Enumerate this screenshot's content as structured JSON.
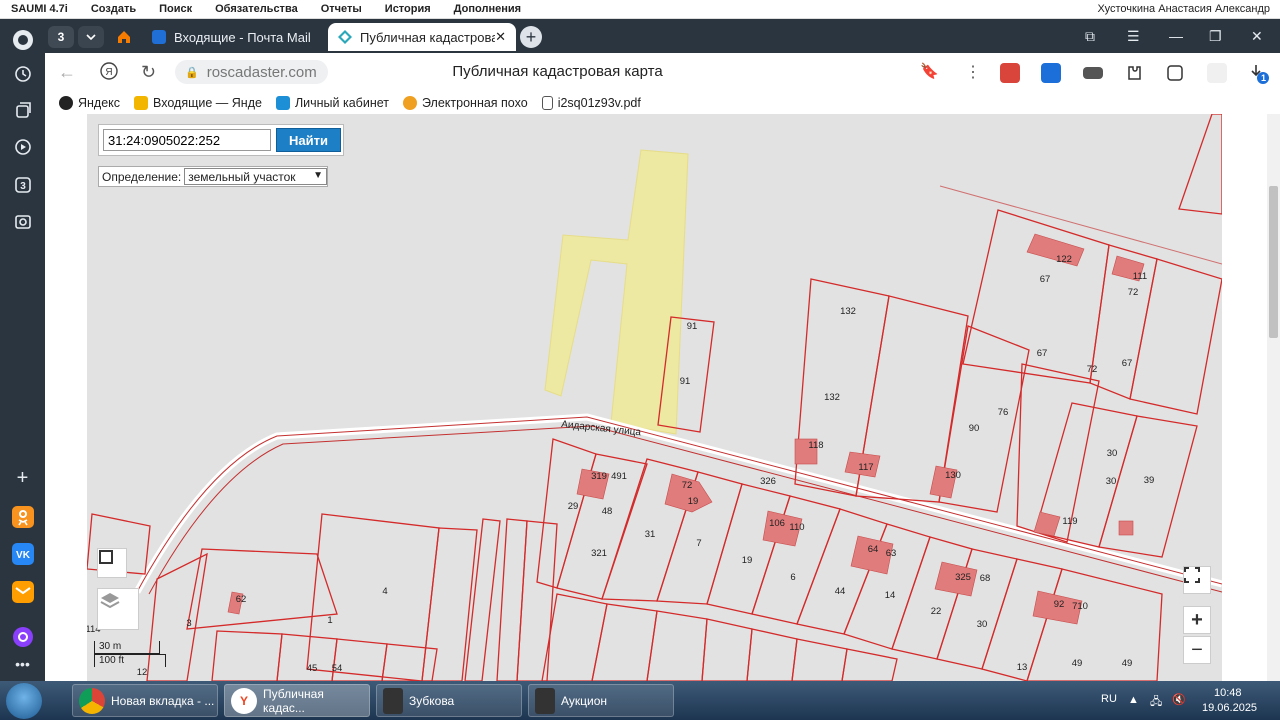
{
  "menubar": {
    "items": [
      "SAUMI 4.7i",
      "Создать",
      "Поиск",
      "Обязательства",
      "Отчеты",
      "История",
      "Дополнения"
    ],
    "user": "Хусточкина Анастасия Александр"
  },
  "browser": {
    "tab_counter": "3",
    "tabs": [
      {
        "label": "Входящие - Почта Mail",
        "active": false
      },
      {
        "label": "Публичная кадастрова",
        "active": true
      }
    ],
    "url": "roscadaster.com",
    "page_title": "Публичная кадастровая карта",
    "download_count": "1"
  },
  "bookmarks": [
    {
      "label": "Яндекс",
      "icon": "yandex-plus-icon"
    },
    {
      "label": "Входящие — Янде",
      "icon": "mail-icon"
    },
    {
      "label": "Личный кабинет",
      "icon": "cabinet-icon"
    },
    {
      "label": "Электронная похо",
      "icon": "electronic-icon"
    },
    {
      "label": "i2sq01z93v.pdf",
      "icon": "file-icon"
    }
  ],
  "map": {
    "search_value": "31:24:0905022:252",
    "search_button": "Найти",
    "definition_label": "Определение:",
    "definition_value": "земельный участок",
    "scale_m": "30 m",
    "scale_ft": "100 ft",
    "street_label": "Аидарская улица",
    "parcel_labels": [
      "91",
      "91",
      "132",
      "132",
      "122",
      "67",
      "67",
      "111",
      "72",
      "72",
      "67",
      "76",
      "90",
      "118",
      "117",
      "130",
      "30",
      "39",
      "30",
      "119",
      "326",
      "319",
      "491",
      "48",
      "29",
      "72",
      "19",
      "31",
      "7",
      "106",
      "110",
      "19",
      "6",
      "64",
      "63",
      "44",
      "14",
      "325",
      "68",
      "22",
      "30",
      "92",
      "710",
      "321",
      "4",
      "62",
      "1",
      "3",
      "45",
      "54",
      "13",
      "49",
      "49",
      "114",
      "12"
    ],
    "zoom_in": "+",
    "zoom_out": "−",
    "fullscreen_icon": "fullscreen-icon",
    "layers_icon": "layers-icon"
  },
  "taskbar": {
    "items": [
      {
        "label": "Новая вкладка - ...",
        "active": false
      },
      {
        "label": "Публичная кадас...",
        "active": true
      },
      {
        "label": "Зубкова",
        "active": false
      },
      {
        "label": "Аукцион",
        "active": false
      }
    ],
    "lang": "RU",
    "time": "10:48",
    "date": "19.06.2025"
  },
  "colors": {
    "parcel_stroke": "#d42a2a",
    "building_fill": "#e07c7c",
    "selected_parcel": "#ede8a2",
    "map_bg": "#e2e2e2",
    "search_button": "#1d7fc6",
    "sidebar": "#2b3540"
  }
}
